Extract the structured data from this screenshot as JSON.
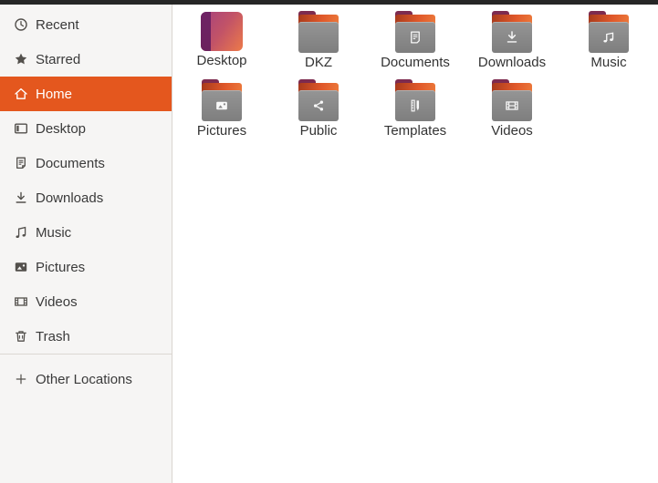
{
  "sidebar": {
    "items": [
      {
        "label": "Recent",
        "icon": "clock-icon",
        "selected": false
      },
      {
        "label": "Starred",
        "icon": "star-icon",
        "selected": false
      },
      {
        "label": "Home",
        "icon": "home-icon",
        "selected": true
      },
      {
        "label": "Desktop",
        "icon": "desktop-icon",
        "selected": false
      },
      {
        "label": "Documents",
        "icon": "document-icon",
        "selected": false
      },
      {
        "label": "Downloads",
        "icon": "download-icon",
        "selected": false
      },
      {
        "label": "Music",
        "icon": "music-note-icon",
        "selected": false
      },
      {
        "label": "Pictures",
        "icon": "image-icon",
        "selected": false
      },
      {
        "label": "Videos",
        "icon": "film-icon",
        "selected": false
      },
      {
        "label": "Trash",
        "icon": "trash-icon",
        "selected": false
      }
    ],
    "footer_item": {
      "label": "Other Locations",
      "icon": "plus-icon"
    }
  },
  "main": {
    "folders": [
      {
        "label": "Desktop",
        "icon": "desktop-gradient-folder",
        "glyph": ""
      },
      {
        "label": "DKZ",
        "icon": "folder",
        "glyph": ""
      },
      {
        "label": "Documents",
        "icon": "folder",
        "glyph": "document-glyph"
      },
      {
        "label": "Downloads",
        "icon": "folder",
        "glyph": "download-glyph"
      },
      {
        "label": "Music",
        "icon": "folder",
        "glyph": "music-glyph"
      },
      {
        "label": "Pictures",
        "icon": "folder",
        "glyph": "image-glyph"
      },
      {
        "label": "Public",
        "icon": "folder",
        "glyph": "share-glyph"
      },
      {
        "label": "Templates",
        "icon": "folder",
        "glyph": "templates-glyph"
      },
      {
        "label": "Videos",
        "icon": "folder",
        "glyph": "film-glyph"
      }
    ]
  },
  "colors": {
    "accent": "#E4571E",
    "sidebar_bg": "#F6F5F4",
    "folder_tab": "#7D2B4F",
    "folder_back": "#E0582A",
    "folder_front": "#8A8A8A"
  }
}
